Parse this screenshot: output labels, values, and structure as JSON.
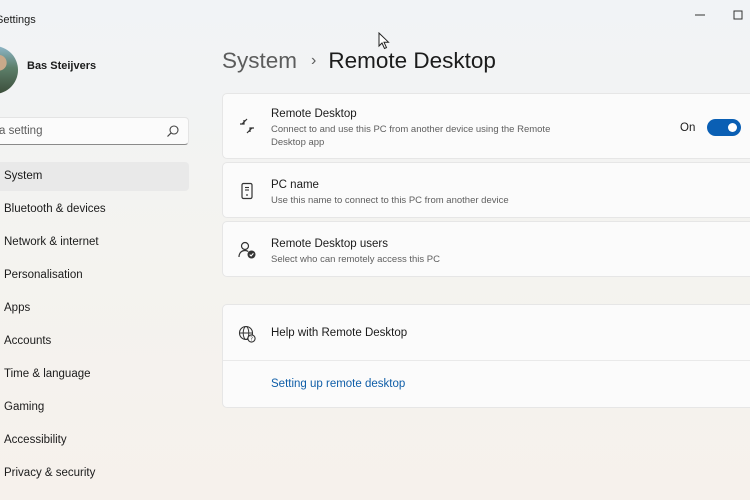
{
  "window": {
    "title": "Settings",
    "minimize_icon": "minimize-icon",
    "maximize_icon": "maximize-icon"
  },
  "user": {
    "name": "Bas Steijvers"
  },
  "search": {
    "placeholder": "a setting",
    "icon": "search-icon"
  },
  "nav": {
    "items": [
      {
        "label": "System",
        "selected": true
      },
      {
        "label": "Bluetooth & devices"
      },
      {
        "label": "Network & internet"
      },
      {
        "label": "Personalisation"
      },
      {
        "label": "Apps"
      },
      {
        "label": "Accounts"
      },
      {
        "label": "Time & language"
      },
      {
        "label": "Gaming"
      },
      {
        "label": "Accessibility"
      },
      {
        "label": "Privacy & security"
      }
    ]
  },
  "breadcrumb": {
    "parent": "System",
    "separator": "›",
    "current": "Remote Desktop"
  },
  "remote_desktop": {
    "title": "Remote Desktop",
    "description": "Connect to and use this PC from another device using the Remote Desktop app",
    "toggle_label": "On",
    "toggle_on": true,
    "icon": "remote-desktop-icon"
  },
  "pc_name": {
    "title": "PC name",
    "description": "Use this name to connect to this PC from another device",
    "icon": "pc-name-icon"
  },
  "users": {
    "title": "Remote Desktop users",
    "description": "Select who can remotely access this PC",
    "icon": "users-icon"
  },
  "help": {
    "title": "Help with Remote Desktop",
    "link": "Setting up remote desktop",
    "icon": "globe-icon"
  },
  "colors": {
    "accent": "#0a5fb4",
    "link": "#0f5ea8"
  }
}
